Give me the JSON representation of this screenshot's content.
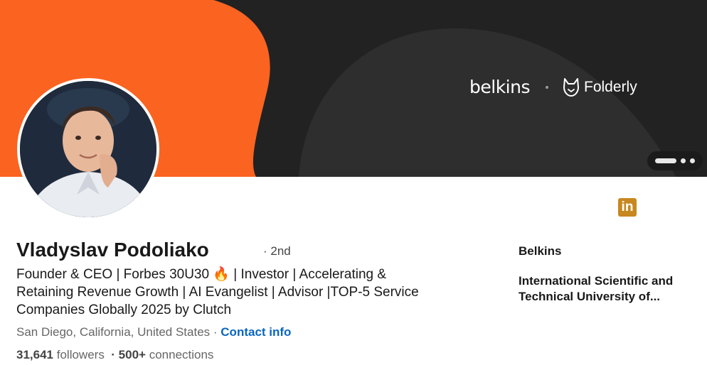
{
  "banner": {
    "brand_belkins": "belkins",
    "brand_folderly": "Folderly",
    "colors": {
      "orange": "#fb6320",
      "dark": "#222222",
      "dark_shape": "#2e2e2e"
    }
  },
  "profile": {
    "name": "Vladyslav Podoliako",
    "degree": "· 2nd",
    "headline": "Founder & CEO | Forbes 30U30 🔥 | Investor | Accelerating & Retaining Revenue Growth | AI Evangelist | Advisor |TOP-5 Service Companies Globally 2025 by Clutch",
    "location": "San Diego, California, United States ·",
    "contact_label": "Contact info",
    "followers_count": "31,641",
    "followers_label": "followers",
    "connections_count": "· 500+",
    "connections_label": "connections"
  },
  "sidebar": {
    "linkedin_badge": "in",
    "company": "Belkins",
    "school": "International Scientific and Technical University of..."
  },
  "colors": {
    "link": "#0a66c2",
    "linkedin_gold": "#c7881f"
  }
}
